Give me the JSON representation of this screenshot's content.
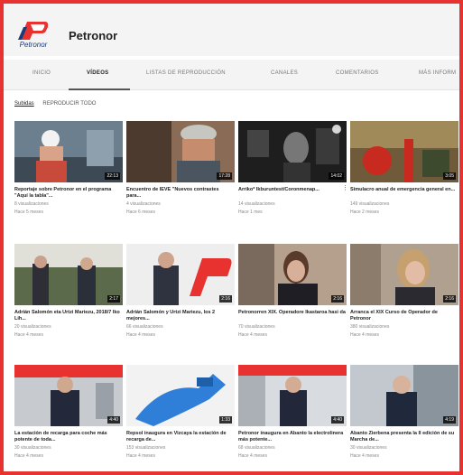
{
  "channel": {
    "name": "Petronor",
    "logo_text": "Petronor"
  },
  "tabs": [
    {
      "label": "INICIO",
      "active": false
    },
    {
      "label": "VÍDEOS",
      "active": true
    },
    {
      "label": "LISTAS DE REPRODUCCIÓN",
      "active": false
    },
    {
      "label": "CANALES",
      "active": false
    },
    {
      "label": "COMENTARIOS",
      "active": false
    },
    {
      "label": "MÁS INFORM",
      "active": false
    }
  ],
  "filters": {
    "uploads": "Subidas",
    "play_all": "REPRODUCIR TODO"
  },
  "videos": [
    {
      "title": "Reportaje sobre Petronor en el programa \"Aquí la tabla\"...",
      "views": "8 visualizaciones",
      "age": "Hace 5 meses",
      "duration": "22:13"
    },
    {
      "title": "Encuentro de IEVE \"Nuevos contrastes para...",
      "views": "4 visualizaciones",
      "age": "Hace 6 meses",
      "duration": "17:28"
    },
    {
      "title": "Arriko* Ikburuntest/Coronmenap...",
      "views": "14 visualizaciones",
      "age": "Hace 1 mes",
      "duration": "14:02"
    },
    {
      "title": "Simulacro anual de emergencia general en...",
      "views": "149 visualizaciones",
      "age": "Hace 2 meses",
      "duration": "3:05"
    },
    {
      "title": "Adrián Salomón eta Urtzi Mariezu, 2018/7 lko Lih...",
      "views": "20 visualizaciones",
      "age": "Hace 4 meses",
      "duration": "2:17"
    },
    {
      "title": "Adrián Salomón y Urtzi Mariezu, los 2 mejores...",
      "views": "66 visualizaciones",
      "age": "Hace 4 meses",
      "duration": "2:16"
    },
    {
      "title": "Petronorren XIX. Operadore Ikastaroa hasi da",
      "views": "70 visualizaciones",
      "age": "Hace 4 meses",
      "duration": "2:16"
    },
    {
      "title": "Arranca el XIX Curso de Operador de Petronor",
      "views": "380 visualizaciones",
      "age": "Hace 4 meses",
      "duration": "2:16"
    },
    {
      "title": "La estación de recarga para coche más potente de toda...",
      "views": "30 visualizaciones",
      "age": "Hace 4 meses",
      "duration": "4:40"
    },
    {
      "title": "Repsol inaugura en Vizcaya la estación de recarga de...",
      "views": "153 visualizaciones",
      "age": "Hace 4 meses",
      "duration": "1:33"
    },
    {
      "title": "Petronor inaugura en Abanto la electrolinera más potente...",
      "views": "68 visualizaciones",
      "age": "Hace 4 meses",
      "duration": "4:40"
    },
    {
      "title": "Abanto Zierbena presenta la II edición de su Marcha de...",
      "views": "30 visualizaciones",
      "age": "Hace 4 meses",
      "duration": "4:19"
    }
  ],
  "colors": {
    "brand_red": "#e8322f",
    "brand_blue": "#1a3a7a"
  }
}
